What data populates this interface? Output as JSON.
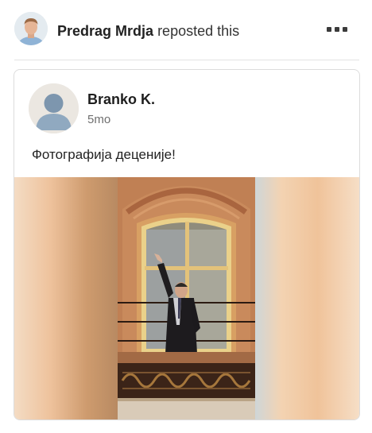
{
  "repost": {
    "name": "Predrag Mrdja",
    "action": "reposted this",
    "avatar_icon": "person-avatar-photo",
    "menu_icon": "more-options-icon"
  },
  "post": {
    "author": "Branko K.",
    "time": "5mo",
    "avatar_icon": "default-avatar-icon",
    "text": "Фотографија деценије!",
    "image_icon": "photo-man-on-balcony"
  },
  "colors": {
    "text_primary": "#1d1d1d",
    "text_secondary": "#6f6f6f",
    "border": "#dcdcdc",
    "facade": "#b9784f"
  }
}
